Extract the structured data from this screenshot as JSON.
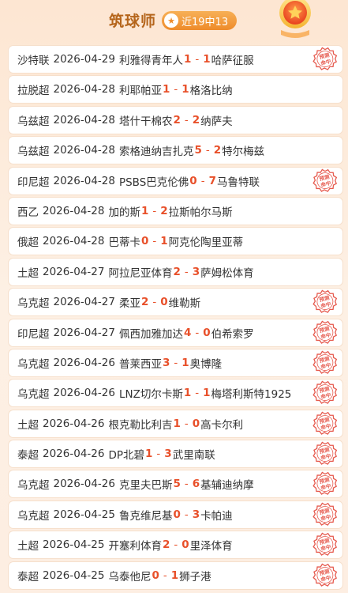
{
  "header": {
    "title": "筑球师",
    "badge": "近19中13"
  },
  "stamp_text": [
    "预测",
    "命中"
  ],
  "matches": [
    {
      "league": "沙特联",
      "date": "2026-04-29",
      "home": "利雅得青年人",
      "hs": "1",
      "as": "1",
      "away": "哈萨征服",
      "hit": true
    },
    {
      "league": "拉脱超",
      "date": "2026-04-28",
      "home": "利耶帕亚",
      "hs": "1",
      "as": "1",
      "away": "格洛比纳",
      "hit": false
    },
    {
      "league": "乌兹超",
      "date": "2026-04-28",
      "home": "塔什干棉农",
      "hs": "2",
      "as": "2",
      "away": "纳萨夫",
      "hit": false
    },
    {
      "league": "乌兹超",
      "date": "2026-04-28",
      "home": "索格迪纳吉扎克",
      "hs": "5",
      "as": "2",
      "away": "特尔梅兹",
      "hit": false
    },
    {
      "league": "印尼超",
      "date": "2026-04-28",
      "home": "PSBS巴克伦佛",
      "hs": "0",
      "as": "7",
      "away": "马鲁特联",
      "hit": true
    },
    {
      "league": "西乙",
      "date": "2026-04-28",
      "home": "加的斯",
      "hs": "1",
      "as": "2",
      "away": "拉斯帕尔马斯",
      "hit": false
    },
    {
      "league": "俄超",
      "date": "2026-04-28",
      "home": "巴蒂卡",
      "hs": "0",
      "as": "1",
      "away": "阿克伦陶里亚蒂",
      "hit": false
    },
    {
      "league": "土超",
      "date": "2026-04-27",
      "home": "阿拉尼亚体育",
      "hs": "2",
      "as": "3",
      "away": "萨姆松体育",
      "hit": false
    },
    {
      "league": "乌克超",
      "date": "2026-04-27",
      "home": "柔亚",
      "hs": "2",
      "as": "0",
      "away": "维勒斯",
      "hit": true
    },
    {
      "league": "印尼超",
      "date": "2026-04-27",
      "home": "佩西加雅加达",
      "hs": "4",
      "as": "0",
      "away": "伯希索罗",
      "hit": true
    },
    {
      "league": "乌克超",
      "date": "2026-04-26",
      "home": "普莱西亚",
      "hs": "3",
      "as": "1",
      "away": "奥博隆",
      "hit": true
    },
    {
      "league": "乌克超",
      "date": "2026-04-26",
      "home": "LNZ切尔卡斯",
      "hs": "1",
      "as": "1",
      "away": "梅塔利斯特1925",
      "hit": true
    },
    {
      "league": "土超",
      "date": "2026-04-26",
      "home": "根克勒比利吉",
      "hs": "1",
      "as": "0",
      "away": "高卡尔利",
      "hit": true
    },
    {
      "league": "泰超",
      "date": "2026-04-26",
      "home": "DP北碧",
      "hs": "1",
      "as": "3",
      "away": "武里南联",
      "hit": true
    },
    {
      "league": "乌克超",
      "date": "2026-04-26",
      "home": "克里夫巴斯",
      "hs": "5",
      "as": "6",
      "away": "基辅迪纳摩",
      "hit": true
    },
    {
      "league": "乌克超",
      "date": "2026-04-25",
      "home": "鲁克维尼基",
      "hs": "0",
      "as": "3",
      "away": "卡帕迪",
      "hit": true
    },
    {
      "league": "土超",
      "date": "2026-04-25",
      "home": "开塞利体育",
      "hs": "2",
      "as": "0",
      "away": "里泽体育",
      "hit": true
    },
    {
      "league": "泰超",
      "date": "2026-04-25",
      "home": "乌泰他尼",
      "hs": "0",
      "as": "1",
      "away": "狮子港",
      "hit": true
    }
  ]
}
